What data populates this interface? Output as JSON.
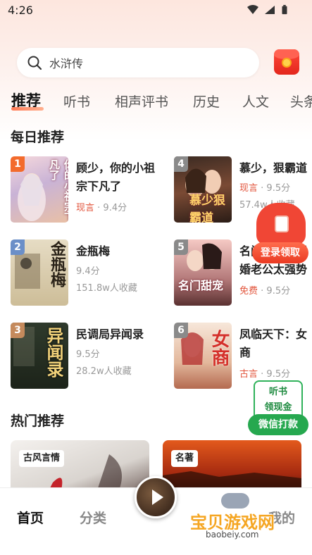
{
  "status_bar": {
    "time": "4:26"
  },
  "search": {
    "query": "水浒传"
  },
  "tabs": [
    "推荐",
    "听书",
    "相声评书",
    "历史",
    "人文",
    "头条"
  ],
  "daily_section": {
    "title": "每日推荐"
  },
  "books": [
    {
      "rank": "1",
      "title": "顾少，你的小祖宗下凡了",
      "tag": "现言",
      "rating": "9.4分",
      "collect": "",
      "cover_text": "你的小祖宗下凡了"
    },
    {
      "rank": "4",
      "title": "慕少，狠霸道",
      "tag": "现言",
      "rating": "9.5分",
      "collect": "57.4w人收藏",
      "cover_text": "慕少狠霸道"
    },
    {
      "rank": "2",
      "title": "金瓶梅",
      "tag": "",
      "rating": "9.4分",
      "collect": "151.8w人收藏",
      "cover_text": "金瓶梅"
    },
    {
      "rank": "5",
      "title": "名门甜宠：闪婚老公太强势",
      "tag": "免费",
      "rating": "9.5分",
      "collect": "",
      "cover_text": "名门甜宠"
    },
    {
      "rank": "3",
      "title": "民调局异闻录",
      "tag": "",
      "rating": "9.5分",
      "collect": "28.2w人收藏",
      "cover_text": "异闻录"
    },
    {
      "rank": "6",
      "title": "凤临天下：女商",
      "tag": "古言",
      "rating": "9.5分",
      "collect": "",
      "cover_text": "女商"
    }
  ],
  "login_reward": {
    "label": "登录领取"
  },
  "listen_reward": {
    "line1": "听书",
    "line2": "领现金",
    "button": "微信打款"
  },
  "hot_section": {
    "title": "热门推荐"
  },
  "hot_cards": [
    {
      "label": "古风言情"
    },
    {
      "label": "名著"
    }
  ],
  "bottom_nav": {
    "home": "首页",
    "category": "分类",
    "mine": "我的"
  },
  "watermark": {
    "text": "宝贝游戏网",
    "url": "baobeiy.com"
  },
  "colors": {
    "accent": "#e2543b",
    "green": "#26a84f"
  }
}
